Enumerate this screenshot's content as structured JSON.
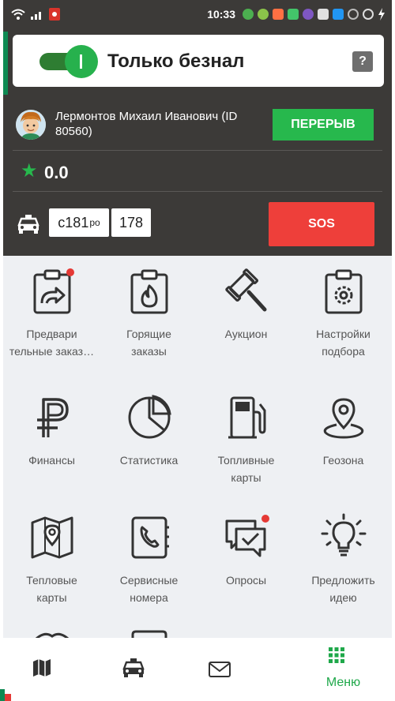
{
  "status_bar": {
    "time": "10:33",
    "notification_icons": [
      "green-circle-icon",
      "green-circle-icon",
      "orange-icon",
      "green-icon",
      "purple-icon",
      "gray-icon",
      "blue-icon",
      "circle-icon",
      "alarm-icon",
      "battery-icon"
    ]
  },
  "cashless_toggle": {
    "label": "Только безнал",
    "state": "on",
    "help_symbol": "?"
  },
  "driver": {
    "name": "Лермонтов Михаил Иванович (ID 80560)",
    "break_button": "ПЕРЕРЫВ"
  },
  "rating": {
    "value": "0.0"
  },
  "car": {
    "plate_number": "с181",
    "plate_series": "ро",
    "plate_region": "178",
    "sos_button": "SOS"
  },
  "menu": {
    "items": [
      {
        "label": "Предвари\nтельные заказ…",
        "icon": "preorder-clipboard-icon",
        "badge": true
      },
      {
        "label": "Горящие\nзаказы",
        "icon": "hot-orders-clipboard-icon",
        "badge": false
      },
      {
        "label": "Аукцион",
        "icon": "auction-hammer-icon",
        "badge": false
      },
      {
        "label": "Настройки\nподбора",
        "icon": "selection-settings-icon",
        "badge": false
      },
      {
        "label": "Финансы",
        "icon": "ruble-icon",
        "badge": false
      },
      {
        "label": "Статистика",
        "icon": "pie-chart-icon",
        "badge": false
      },
      {
        "label": "Топливные\nкарты",
        "icon": "fuel-pump-icon",
        "badge": false
      },
      {
        "label": "Геозона",
        "icon": "map-pin-icon",
        "badge": false
      },
      {
        "label": "Тепловые\nкарты",
        "icon": "heat-map-icon",
        "badge": false
      },
      {
        "label": "Сервисные\nномера",
        "icon": "phone-book-icon",
        "badge": false
      },
      {
        "label": "Опросы",
        "icon": "survey-icon",
        "badge": true
      },
      {
        "label": "Предложить\nидею",
        "icon": "idea-bulb-icon",
        "badge": false
      }
    ]
  },
  "bottom_nav": {
    "items": [
      {
        "label": "",
        "icon": "map-icon",
        "active": false
      },
      {
        "label": "",
        "icon": "car-icon",
        "active": false
      },
      {
        "label": "",
        "icon": "mail-icon",
        "active": false
      },
      {
        "label": "Меню",
        "icon": "grid-menu-icon",
        "active": true
      }
    ]
  },
  "colors": {
    "accent_green": "#27b84d",
    "sos_red": "#ee3f3a",
    "header_dark": "#3c3a38",
    "menu_bg": "#eef0f3",
    "badge_red": "#e53935"
  }
}
